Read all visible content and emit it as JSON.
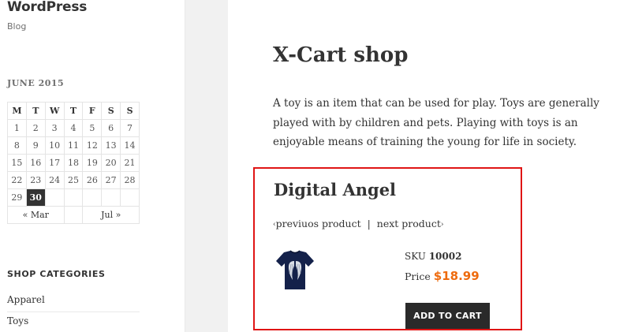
{
  "site": {
    "title": "WordPress",
    "description": "Blog"
  },
  "calendar": {
    "caption": "JUNE 2015",
    "weekdays": [
      "M",
      "T",
      "W",
      "T",
      "F",
      "S",
      "S"
    ],
    "weeks": [
      [
        "1",
        "2",
        "3",
        "4",
        "5",
        "6",
        "7"
      ],
      [
        "8",
        "9",
        "10",
        "11",
        "12",
        "13",
        "14"
      ],
      [
        "15",
        "16",
        "17",
        "18",
        "19",
        "20",
        "21"
      ],
      [
        "22",
        "23",
        "24",
        "25",
        "26",
        "27",
        "28"
      ],
      [
        "29",
        "30",
        "",
        "",
        "",
        "",
        ""
      ]
    ],
    "today": "30",
    "prev": "« Mar",
    "next": "Jul »"
  },
  "shop_categories": {
    "title": "SHOP CATEGORIES",
    "items": [
      "Apparel",
      "Toys"
    ]
  },
  "page": {
    "title": "X-Cart shop",
    "intro": "A toy is an item that can be used for play. Toys are generally played with by children and pets. Playing with toys is an enjoyable means of training the young for life in society."
  },
  "product": {
    "title": "Digital Angel",
    "prev_label": "previuos product",
    "next_label": "next product",
    "separator": "|",
    "sku_label": "SKU",
    "sku": "10002",
    "price_label": "Price",
    "price": "$18.99",
    "add_to_cart": "ADD TO CART",
    "thumbnail_icon": "tshirt-angel-wings-icon"
  },
  "colors": {
    "accent_price": "#ee6b0e",
    "highlight_border": "#e01515",
    "button_bg": "#2a2a2a"
  }
}
